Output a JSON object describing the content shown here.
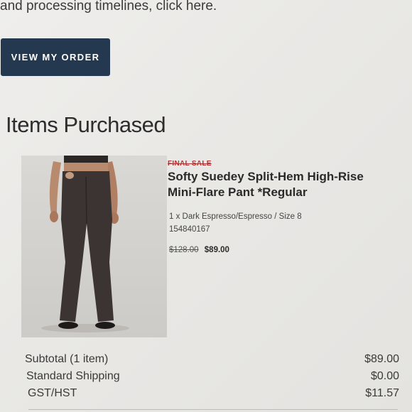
{
  "header": {
    "processing_text": "and processing timelines, click here.",
    "view_order_label": "VIEW MY ORDER"
  },
  "section": {
    "title": "Items Purchased"
  },
  "product": {
    "badge": "FINAL SALE",
    "title": "Softy Suedey Split-Hem High-Rise Mini-Flare Pant *Regular",
    "variant": "1 x Dark Espresso/Espresso / Size 8",
    "sku": "154840167",
    "original_price": "$128.00",
    "sale_price": "$89.00",
    "image_icon": "product-photo-icon"
  },
  "totals": [
    {
      "label": "Subtotal (1 item)",
      "value": "$89.00"
    },
    {
      "label": "Standard Shipping",
      "value": "$0.00"
    },
    {
      "label": "GST/HST",
      "value": "$11.57"
    }
  ],
  "colors": {
    "button_bg": "#24384f",
    "final_sale": "#b03434",
    "background": "#ecebe8"
  }
}
